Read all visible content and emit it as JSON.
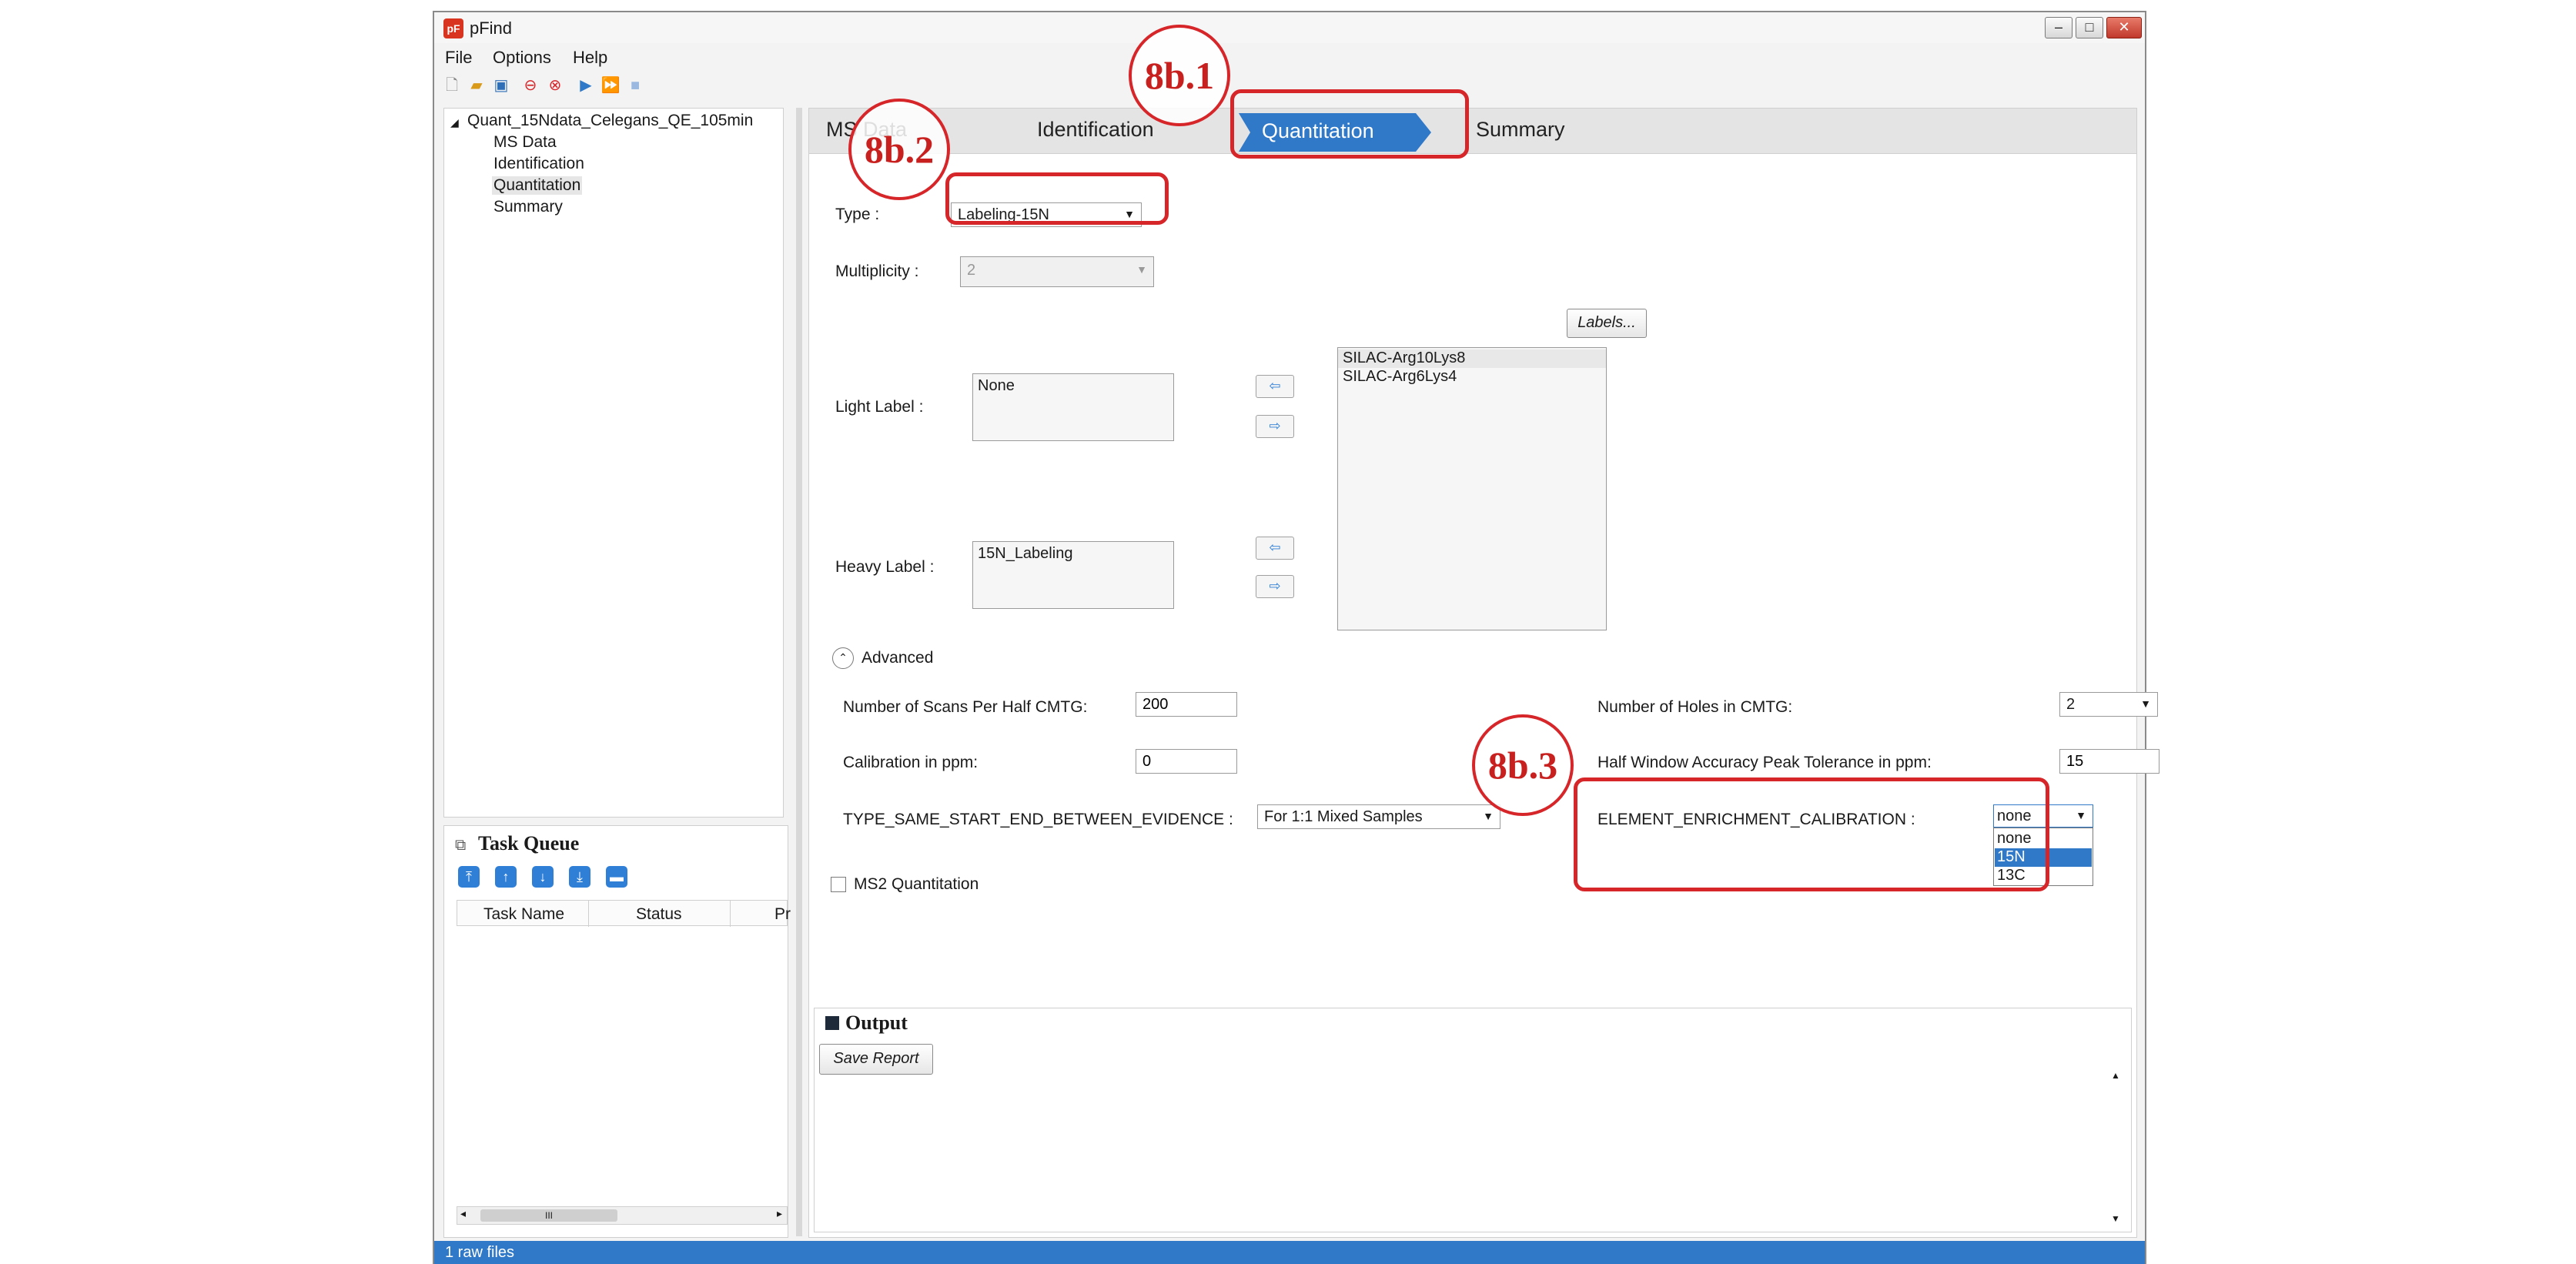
{
  "app": {
    "title": "pFind",
    "icon_text": "pF"
  },
  "window_controls": {
    "minimize": "–",
    "maximize": "□",
    "close": "✕"
  },
  "menu": [
    "File",
    "Options",
    "Help"
  ],
  "toolbar_icons": [
    "new-file-icon",
    "open-folder-icon",
    "save-icon",
    "stop-icon",
    "cancel-icon",
    "run-icon",
    "run-all-icon",
    "halt-icon"
  ],
  "tree": {
    "root": "Quant_15Ndata_Celegans_QE_105min",
    "children": [
      "MS Data",
      "Identification",
      "Quantitation",
      "Summary"
    ],
    "selected": "Quantitation"
  },
  "task_queue": {
    "title": "Task Queue",
    "columns": [
      "Task Name",
      "Status",
      "Pr"
    ],
    "scroll_thumb": "III"
  },
  "tabs": {
    "items": [
      "MS Data",
      "Identification",
      "Quantitation",
      "Summary"
    ],
    "active": "Quantitation"
  },
  "form": {
    "type_label": "Type :",
    "type_value": "Labeling-15N",
    "multiplicity_label": "Multiplicity :",
    "multiplicity_value": "2",
    "labels_button": "Labels...",
    "light_label": "Light Label :",
    "light_value": "None",
    "heavy_label": "Heavy Label :",
    "heavy_value": "15N_Labeling",
    "available_labels": [
      "SILAC-Arg10Lys8",
      "SILAC-Arg6Lys4"
    ],
    "arrow_left": "⇦",
    "arrow_right": "⇨"
  },
  "advanced": {
    "title": "Advanced",
    "scans_label": "Number of Scans Per Half CMTG:",
    "scans_value": "200",
    "holes_label": "Number of Holes in CMTG:",
    "holes_value": "2",
    "calibration_label": "Calibration in ppm:",
    "calibration_value": "0",
    "half_window_label": "Half Window Accuracy Peak Tolerance in ppm:",
    "half_window_value": "15",
    "type_same_label": "TYPE_SAME_START_END_BETWEEN_EVIDENCE :",
    "type_same_value": "For 1:1 Mixed Samples",
    "enrichment_label": "ELEMENT_ENRICHMENT_CALIBRATION :",
    "enrichment_value": "none",
    "enrichment_options": [
      "none",
      "15N",
      "13C"
    ],
    "enrichment_highlighted": "15N",
    "ms2_label": "MS2 Quantitation"
  },
  "output": {
    "title": "Output",
    "save_report": "Save Report"
  },
  "status_bar": {
    "text": "1 raw files"
  },
  "annotations": [
    "8b.1",
    "8b.2",
    "8b.3"
  ],
  "colors": {
    "accent": "#2f79c8",
    "annotation_red": "#d7262a",
    "close_red": "#c0392b"
  }
}
